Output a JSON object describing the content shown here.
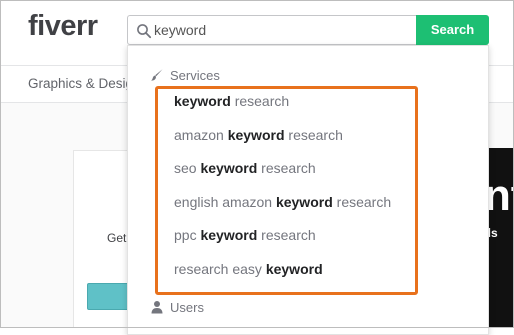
{
  "header": {
    "logo": "fiverr",
    "search": {
      "value": "keyword",
      "button_label": "Search"
    }
  },
  "nav": {
    "items": [
      "Graphics & Design"
    ]
  },
  "background": {
    "promo_text": "Get",
    "dark_panel_big": "nt",
    "dark_panel_small": "als"
  },
  "dropdown": {
    "services_label": "Services",
    "users_label": "Users",
    "suggestions": [
      {
        "pre": "",
        "bold": "keyword",
        "post": " research"
      },
      {
        "pre": "amazon ",
        "bold": "keyword",
        "post": " research"
      },
      {
        "pre": "seo ",
        "bold": "keyword",
        "post": " research"
      },
      {
        "pre": "english amazon ",
        "bold": "keyword",
        "post": " research"
      },
      {
        "pre": "ppc ",
        "bold": "keyword",
        "post": " research"
      },
      {
        "pre": "research easy ",
        "bold": "keyword",
        "post": ""
      }
    ]
  },
  "colors": {
    "brand_green": "#1dbf73",
    "logo_text": "#404145",
    "highlight_orange": "#e8711c"
  }
}
